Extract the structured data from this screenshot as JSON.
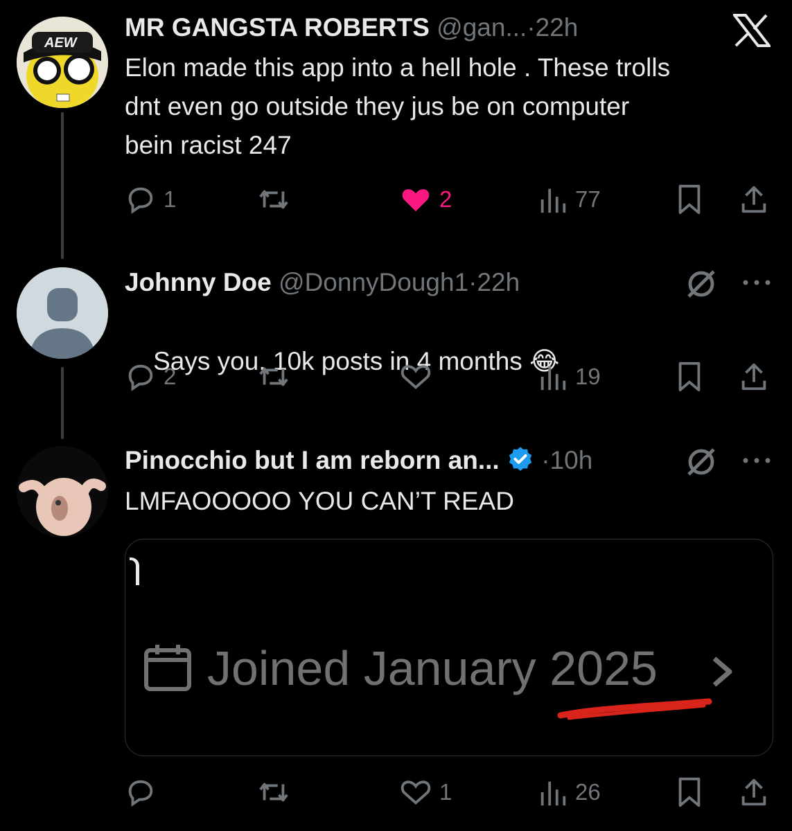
{
  "tweets": [
    {
      "name": "MR GANGSTA ROBERTS",
      "handle": "@gan...",
      "sep": "·",
      "time": "22h",
      "text": "Elon made this app into a hell hole . These trolls\ndnt even go outside they jus be on computer\nbein racist 247",
      "avatar_badge": "AEW",
      "replies": "1",
      "retweets": "",
      "likes": "2",
      "views": "77",
      "liked": true
    },
    {
      "name": "Johnny Doe",
      "handle": "@DonnyDough1",
      "sep": "·",
      "time": "22h",
      "text": "Says you. 10k posts in 4 months",
      "emoji": "😂",
      "replies": "2",
      "retweets": "",
      "likes": "",
      "views": "19",
      "liked": false
    },
    {
      "name": "Pinocchio but I am reborn an...",
      "handle": "",
      "sep": "·",
      "time": "10h",
      "text": "LMFAOOOOO YOU CAN’T READ",
      "verified": true,
      "replies": "",
      "retweets": "",
      "likes": "1",
      "views": "26",
      "liked": false
    }
  ],
  "embed": {
    "joined_text": "Joined January",
    "joined_year": "2025",
    "chevron": ">"
  },
  "colors": {
    "background": "#000000",
    "text": "#e7e9ea",
    "secondary": "#71767b",
    "like": "#f91880",
    "verified": "#1d9bf0",
    "underline": "#d9241c"
  },
  "icons": [
    "x-logo-icon",
    "grok-icon",
    "more-icon",
    "reply-icon",
    "retweet-icon",
    "heart-icon",
    "views-icon",
    "bookmark-icon",
    "share-icon",
    "calendar-icon",
    "verified-badge-icon"
  ]
}
